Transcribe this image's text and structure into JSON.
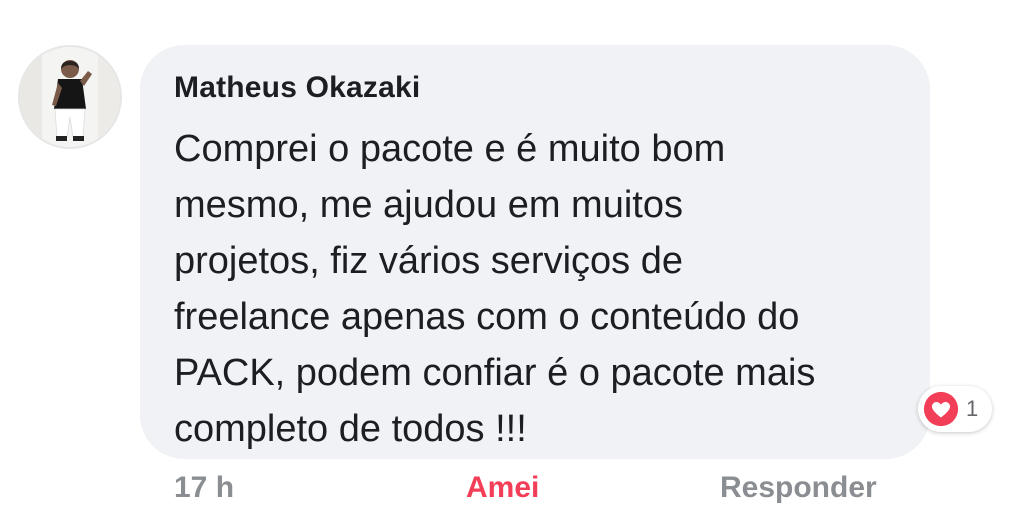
{
  "comment": {
    "author": "Matheus Okazaki",
    "text": "Comprei o pacote e é muito bom\nmesmo, me ajudou em muitos\nprojetos, fiz vários serviços de\nfreelance apenas com o conteúdo do\nPACK, podem confiar é o pacote mais\ncompleto de todos !!!",
    "avatar_icon": "profile-photo"
  },
  "reaction": {
    "icon": "heart-icon",
    "count": "1",
    "color": "#f33e58"
  },
  "actions": {
    "timestamp": "17 h",
    "love_label": "Amei",
    "reply_label": "Responder"
  },
  "colors": {
    "bubble": "#f0f2f5",
    "love": "#f33e58",
    "muted": "#8a8d91"
  }
}
